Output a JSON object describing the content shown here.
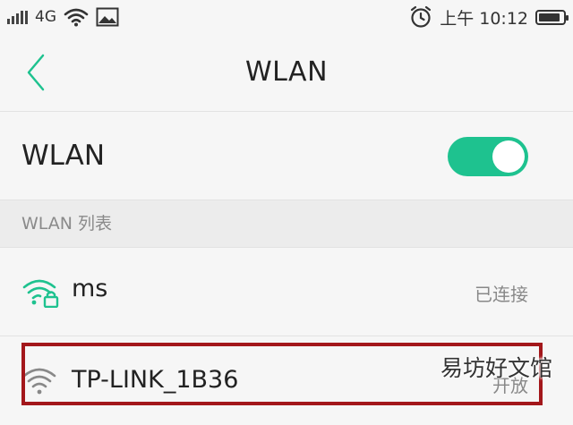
{
  "status_bar": {
    "network_type": "4G",
    "time": "上午 10:12",
    "battery_level": 0.9
  },
  "header": {
    "title": "WLAN"
  },
  "wlan_toggle": {
    "label": "WLAN",
    "enabled": true,
    "accent_color": "#1ec28f"
  },
  "section": {
    "label": "WLAN 列表"
  },
  "networks": [
    {
      "ssid": "ms",
      "status": "已连接",
      "secured": true,
      "icon": "wifi-lock-icon",
      "color": "#1ec28f"
    },
    {
      "ssid": "TP-LINK_1B36",
      "status": "开放",
      "secured": false,
      "icon": "wifi-icon",
      "color": "#888888"
    }
  ],
  "watermark": "易坊好文馆",
  "highlight_color": "#a3171b"
}
